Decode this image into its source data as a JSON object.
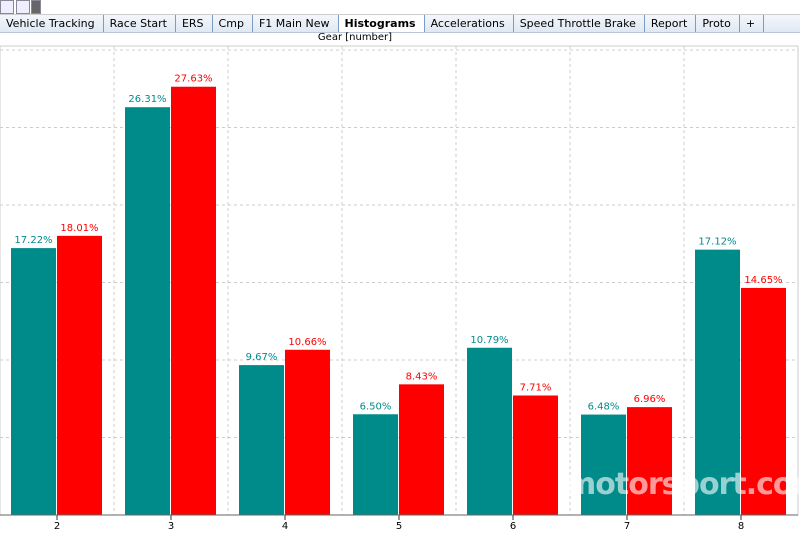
{
  "tabs": [
    "Vehicle Tracking",
    "Race Start",
    "ERS",
    "Cmp",
    "F1 Main New",
    "Histograms",
    "Accelerations",
    "Speed Throttle Brake",
    "Report",
    "Proto",
    "+"
  ],
  "active_tab": "Histograms",
  "chart_data": {
    "type": "bar",
    "title": "Gear [number]",
    "categories": [
      "2",
      "3",
      "4",
      "5",
      "6",
      "7",
      "8"
    ],
    "series": [
      {
        "color": "#008b8b",
        "values": [
          17.22,
          26.31,
          9.67,
          6.5,
          10.79,
          6.48,
          17.12
        ],
        "labels": [
          "17.22%",
          "26.31%",
          "9.67%",
          "6.50%",
          "10.79%",
          "6.48%",
          "17.12%"
        ]
      },
      {
        "color": "#ff0000",
        "values": [
          18.01,
          27.63,
          10.66,
          8.43,
          7.71,
          6.96,
          14.65
        ],
        "labels": [
          "18.01%",
          "27.63%",
          "10.66%",
          "8.43%",
          "7.71%",
          "6.96%",
          "14.65%"
        ]
      }
    ],
    "ylim": [
      0,
      30
    ],
    "ygrid_step": 5,
    "grid": true
  },
  "watermark": "motorsport.com"
}
